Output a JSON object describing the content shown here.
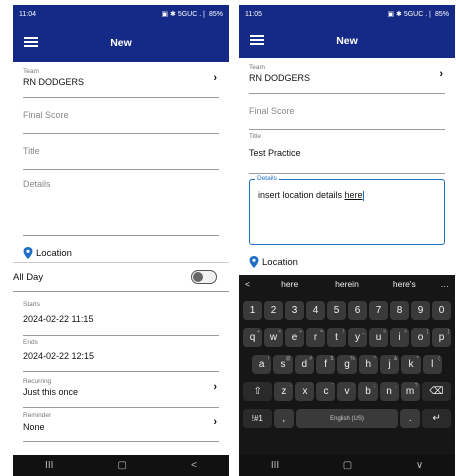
{
  "left": {
    "status": {
      "time": "11:04",
      "icons": "Θ Θ ▣",
      "right": "▣ ✱ 5GUC .❘ 85%"
    },
    "title": "New",
    "team": {
      "label": "Team",
      "value": "RN DODGERS"
    },
    "final_score": {
      "placeholder": "Final Score"
    },
    "title_field": {
      "placeholder": "Title"
    },
    "details": {
      "placeholder": "Details"
    },
    "location": "Location",
    "all_day": "All Day",
    "starts": {
      "label": "Starts",
      "value": "2024-02-22 11:15"
    },
    "ends": {
      "label": "Ends",
      "value": "2024-02-22 12:15"
    },
    "recurring": {
      "label": "Recurring",
      "value": "Just this once"
    },
    "reminder": {
      "label": "Reminder",
      "value": "None"
    },
    "nav": {
      "recents": "III",
      "home": "▢",
      "back": "<"
    }
  },
  "right": {
    "status": {
      "time": "11:05",
      "icons": "Θ Θ ▣",
      "right": "▣ ✱ 5GUC .❘ 85%"
    },
    "title": "New",
    "team": {
      "label": "Team",
      "value": "RN DODGERS"
    },
    "final_score": {
      "placeholder": "Final Score"
    },
    "title_field": {
      "label": "Title",
      "value": "Test Practice"
    },
    "details": {
      "label": "Details",
      "value_prefix": "insert location details ",
      "value_link": "here"
    },
    "location": "Location",
    "keyboard": {
      "suggestions": [
        "here",
        "herein",
        "here's"
      ],
      "more": "…",
      "back_arrow": "<",
      "numbers": [
        "1",
        "2",
        "3",
        "4",
        "5",
        "6",
        "7",
        "8",
        "9",
        "0"
      ],
      "row1": [
        [
          "q",
          "+"
        ],
        [
          "w",
          "×"
        ],
        [
          "e",
          "÷"
        ],
        [
          "r",
          "="
        ],
        [
          "t",
          "/"
        ],
        [
          "y",
          "_"
        ],
        [
          "u",
          "<"
        ],
        [
          "i",
          ">"
        ],
        [
          "o",
          "["
        ],
        [
          "p",
          "]"
        ]
      ],
      "row2": [
        [
          "a",
          "!"
        ],
        [
          "s",
          "@"
        ],
        [
          "d",
          "#"
        ],
        [
          "f",
          "$"
        ],
        [
          "g",
          "%"
        ],
        [
          "h",
          "^"
        ],
        [
          "j",
          "&"
        ],
        [
          "k",
          "*"
        ],
        [
          "l",
          "("
        ]
      ],
      "row3": [
        [
          "z",
          "-"
        ],
        [
          "x",
          "'"
        ],
        [
          "c",
          "\""
        ],
        [
          "v",
          ":"
        ],
        [
          "b",
          ";"
        ],
        [
          "n",
          ","
        ],
        [
          "m",
          "?"
        ]
      ],
      "shift": "⇧",
      "backspace": "⌫",
      "sym": "!#1",
      "comma": ",",
      "space": "English (US)",
      "period": ".",
      "enter": "↵"
    },
    "nav": {
      "recents": "III",
      "home": "▢",
      "back": "∨"
    }
  },
  "colors": {
    "appbar": "#142a86",
    "accent": "#1f6fc4"
  }
}
